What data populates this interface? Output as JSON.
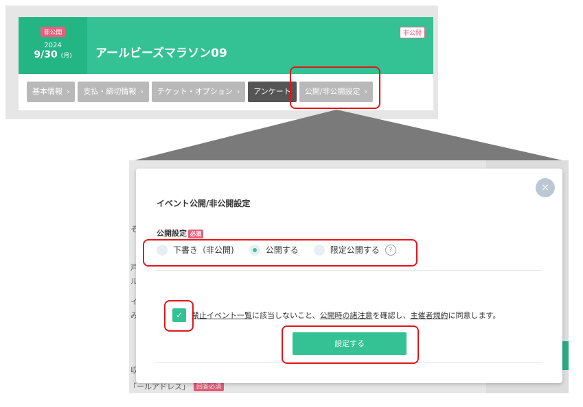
{
  "top": {
    "date": {
      "status": "非公開",
      "year": "2024",
      "day": "9/30",
      "weekday": "(月)"
    },
    "title": "アールビーズマラソン09",
    "status_badge": "非公開",
    "tabs": [
      {
        "label": "基本情報",
        "chev": "›"
      },
      {
        "label": "支払・締切情報",
        "chev": "›"
      },
      {
        "label": "チケット・オプション",
        "chev": "›"
      },
      {
        "label": "アンケート",
        "chev": ""
      },
      {
        "label": "公開/非公開設定",
        "chev": "›"
      }
    ]
  },
  "background": {
    "texts": [
      "そ",
      "戸",
      "ル",
      "イ",
      "み",
      "収",
      "「ールアドレス」"
    ],
    "badge": "回答必須"
  },
  "modal": {
    "close_label": "×",
    "title": "イベント公開/非公開設定",
    "field_label": "公開設定",
    "required_badge": "必須",
    "radios": [
      {
        "label": "下書き（非公開)",
        "checked": false
      },
      {
        "label": "公開する",
        "checked": true
      },
      {
        "label": "限定公開する",
        "checked": false
      }
    ],
    "help_icon": "?",
    "agreement": {
      "check": "✓",
      "link1": "禁止イベント一覧",
      "text1": "に該当しないこと、",
      "link2": "公開時の諸注意",
      "text2": "を確認し、",
      "link3": "主催者規約",
      "text3": "に同意します。"
    },
    "submit_label": "設定する"
  },
  "colors": {
    "brand_green": "#34c294",
    "accent_pink": "#ea5f7e",
    "highlight_red": "#e0161a"
  }
}
